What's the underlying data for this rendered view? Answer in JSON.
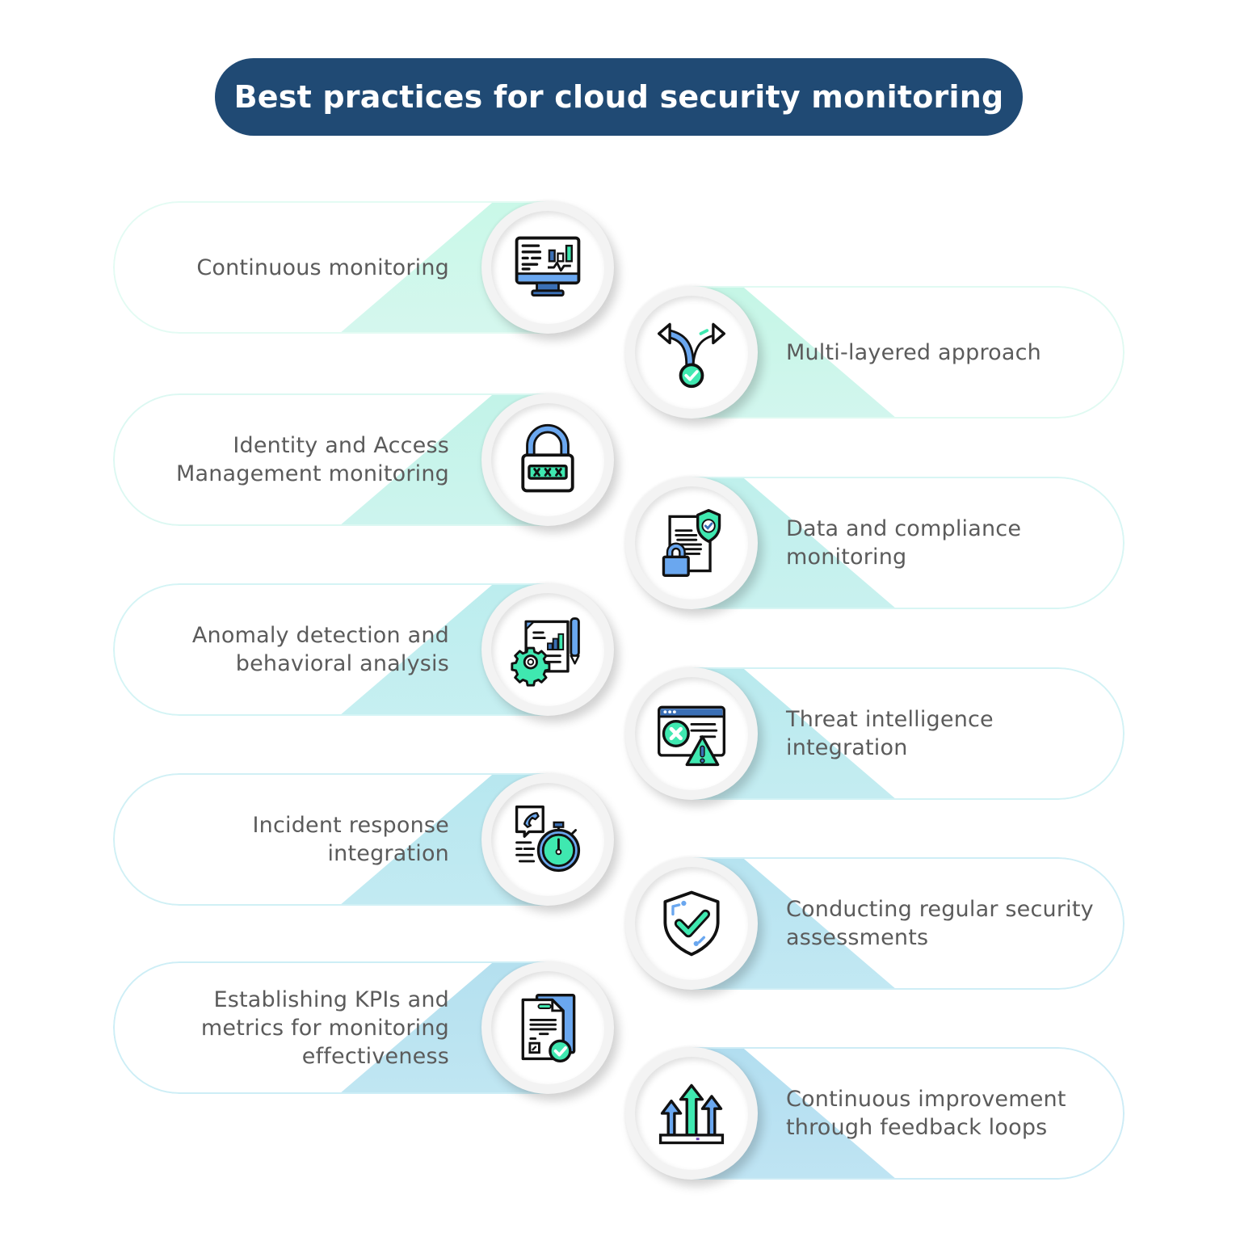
{
  "title": "Best practices for cloud security monitoring",
  "colors": {
    "title_bg": "#204a74",
    "title_text": "#ffffff",
    "label_text": "#5b5b5b",
    "icon_green": "#3fe8b0",
    "icon_blue": "#6aa7ef",
    "icon_darkblue": "#3a6fb5",
    "icon_outline": "#111111",
    "tint_green": "#c9f6e6",
    "tint_cyan": "#bdeaf0"
  },
  "practices": [
    {
      "id": 1,
      "side": "left",
      "icon": "monitor-dashboard-icon",
      "label": "Continuous monitoring"
    },
    {
      "id": 2,
      "side": "right",
      "icon": "split-path-check-icon",
      "label": "Multi-layered approach"
    },
    {
      "id": 3,
      "side": "left",
      "icon": "password-padlock-icon",
      "label": "Identity and Access Management monitoring"
    },
    {
      "id": 4,
      "side": "right",
      "icon": "document-shield-lock-icon",
      "label": "Data and compliance monitoring"
    },
    {
      "id": 5,
      "side": "left",
      "icon": "report-gear-chart-icon",
      "label": "Anomaly detection and behavioral analysis"
    },
    {
      "id": 6,
      "side": "right",
      "icon": "browser-error-warning-icon",
      "label": "Threat intelligence integration"
    },
    {
      "id": 7,
      "side": "left",
      "icon": "phone-stopwatch-icon",
      "label": "Incident response integration"
    },
    {
      "id": 8,
      "side": "right",
      "icon": "shield-check-icon",
      "label": "Conducting regular security assessments"
    },
    {
      "id": 9,
      "side": "left",
      "icon": "checklist-document-icon",
      "label": "Establishing KPIs and metrics for monitoring effectiveness"
    },
    {
      "id": 10,
      "side": "right",
      "icon": "rising-arrows-icon",
      "label": "Continuous improvement through feedback loops"
    }
  ]
}
